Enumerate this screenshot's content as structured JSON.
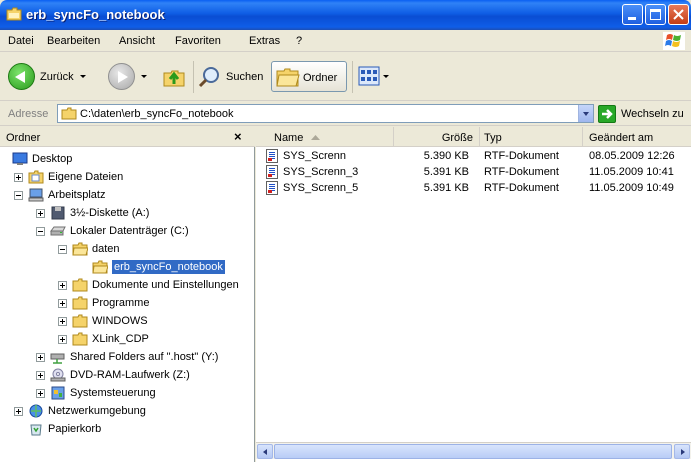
{
  "window": {
    "title": "erb_syncFo_notebook"
  },
  "menubar": {
    "items": [
      {
        "label": "Datei"
      },
      {
        "label": "Bearbeiten"
      },
      {
        "label": "Ansicht"
      },
      {
        "label": "Favoriten"
      },
      {
        "label": "Extras"
      },
      {
        "label": "?"
      }
    ]
  },
  "toolbar": {
    "back_label": "Zurück",
    "search_label": "Suchen",
    "folders_label": "Ordner"
  },
  "addressbar": {
    "label": "Adresse",
    "value": "C:\\daten\\erb_syncFo_notebook",
    "go_label": "Wechseln zu"
  },
  "folderpane": {
    "title": "Ordner",
    "close": "×",
    "tree": [
      {
        "label": "Desktop",
        "icon": "desktop-icon"
      },
      {
        "label": "Eigene Dateien",
        "icon": "my-documents-icon"
      },
      {
        "label": "Arbeitsplatz",
        "icon": "my-computer-icon"
      },
      {
        "label": "3½-Diskette (A:)",
        "icon": "floppy-icon"
      },
      {
        "label": "Lokaler Datenträger (C:)",
        "icon": "hard-drive-icon"
      },
      {
        "label": "daten",
        "icon": "folder-open-icon"
      },
      {
        "label": "erb_syncFo_notebook",
        "icon": "folder-open-icon"
      },
      {
        "label": "Dokumente und Einstellungen",
        "icon": "folder-icon"
      },
      {
        "label": "Programme",
        "icon": "folder-icon"
      },
      {
        "label": "WINDOWS",
        "icon": "folder-icon"
      },
      {
        "label": "XLink_CDP",
        "icon": "folder-icon"
      },
      {
        "label": "Shared Folders auf \".host\" (Y:)",
        "icon": "network-drive-icon"
      },
      {
        "label": "DVD-RAM-Laufwerk (Z:)",
        "icon": "dvd-drive-icon"
      },
      {
        "label": "Systemsteuerung",
        "icon": "control-panel-icon"
      },
      {
        "label": "Netzwerkumgebung",
        "icon": "network-icon"
      },
      {
        "label": "Papierkorb",
        "icon": "recycle-bin-icon"
      }
    ]
  },
  "filelist": {
    "columns": {
      "name": "Name",
      "size": "Größe",
      "type": "Typ",
      "modified": "Geändert am"
    },
    "rows": [
      {
        "name": "SYS_Screnn",
        "size": "5.390 KB",
        "type": "RTF-Dokument",
        "modified": "08.05.2009 12:26"
      },
      {
        "name": "SYS_Screnn_3",
        "size": "5.391 KB",
        "type": "RTF-Dokument",
        "modified": "11.05.2009 10:41"
      },
      {
        "name": "SYS_Screnn_5",
        "size": "5.391 KB",
        "type": "RTF-Dokument",
        "modified": "11.05.2009 10:49"
      }
    ]
  },
  "colors": {
    "titlebar": "#0a4dd3",
    "selection": "#316ac5",
    "chrome": "#ece9d8"
  }
}
